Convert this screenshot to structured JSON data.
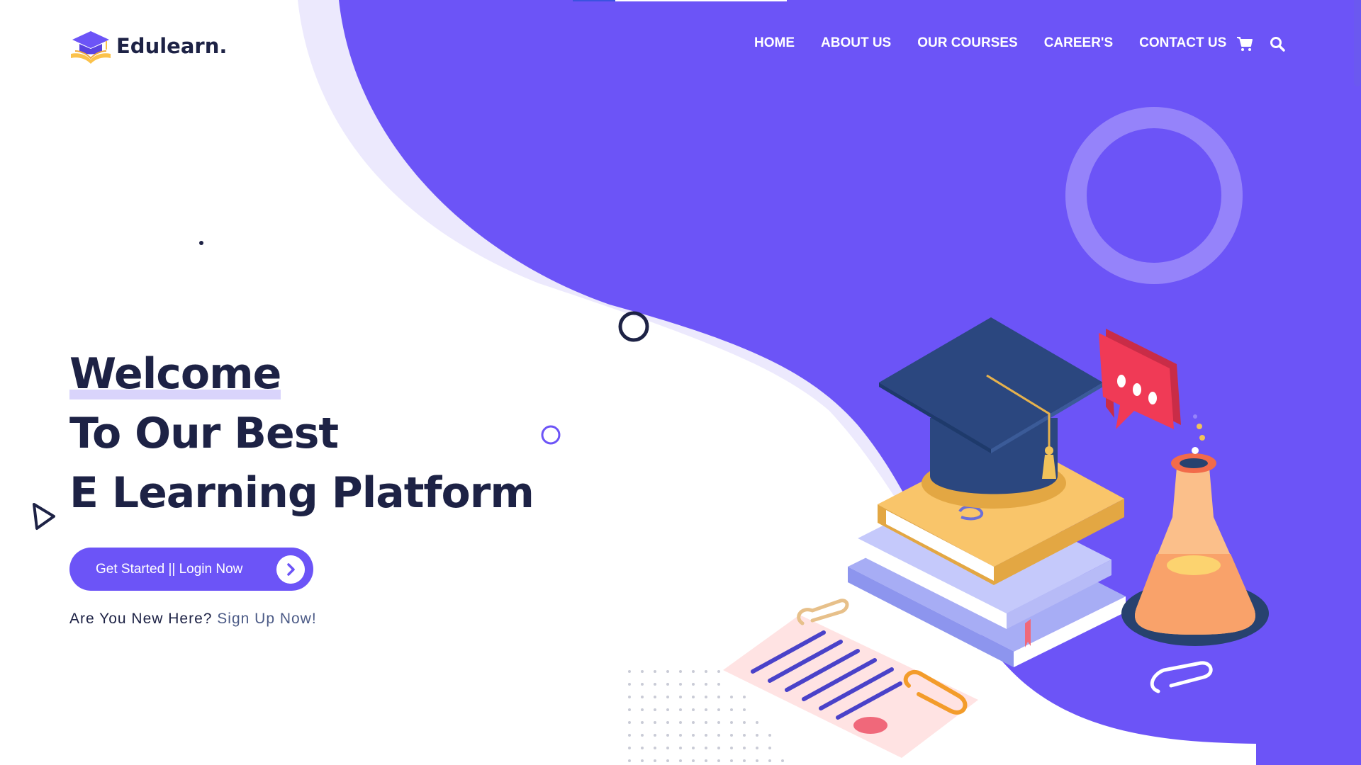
{
  "brand": {
    "name": "Edulearn.",
    "logo_icon": "graduation-cap-book-icon",
    "colors": {
      "primary": "#6c54f7",
      "dark": "#1d2245",
      "accent": "#fbc24b"
    }
  },
  "nav": {
    "items": [
      {
        "label": "HOME"
      },
      {
        "label": "ABOUT US"
      },
      {
        "label": "OUR COURSES"
      },
      {
        "label": "CAREER'S"
      },
      {
        "label": "CONTACT US"
      }
    ],
    "icons": [
      "shopping-cart-icon",
      "search-icon"
    ]
  },
  "hero": {
    "title_lines": [
      "Welcome",
      "To Our Best",
      "E Learning Platform"
    ],
    "cta_label": "Get Started || Login Now",
    "cta_icon": "chevron-right-icon",
    "signup_prefix": "Are You New Here?",
    "signup_link": "Sign Up Now!"
  },
  "illustration": {
    "items": [
      "graduation-cap",
      "books-stack",
      "speech-bubble",
      "flask",
      "certificate",
      "paper-clips"
    ]
  }
}
